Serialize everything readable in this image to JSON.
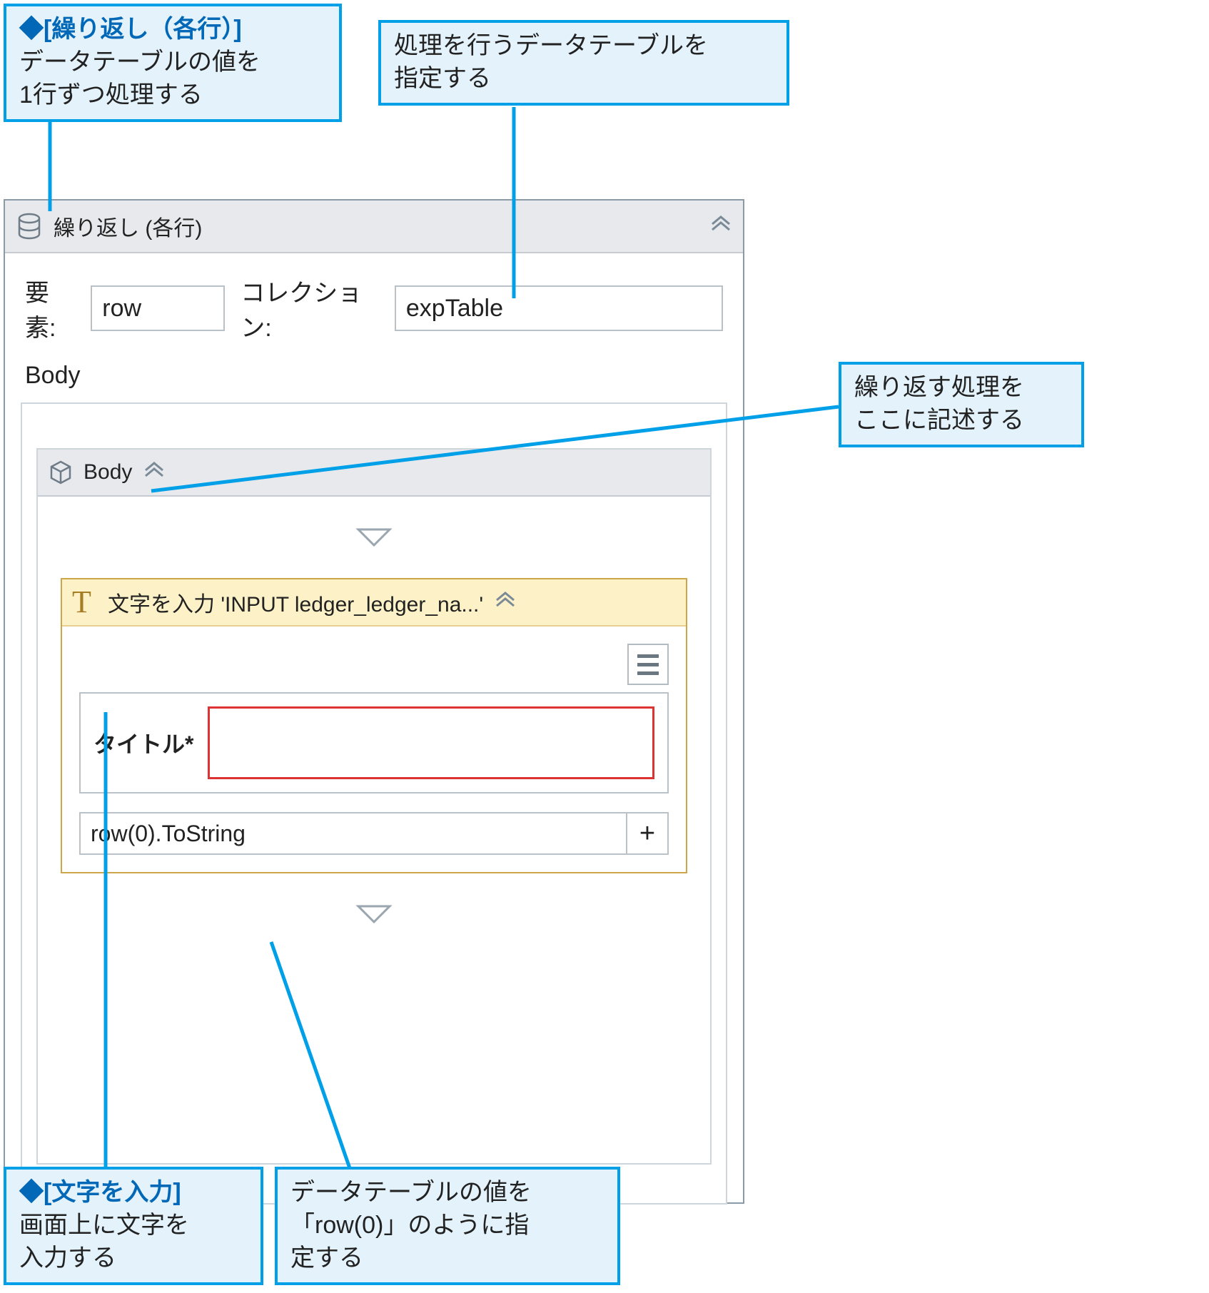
{
  "callouts": {
    "foreach": {
      "lead": "◆[繰り返し（各行）]",
      "line1": "データテーブルの値を",
      "line2": "1行ずつ処理する"
    },
    "datatable": {
      "line1": "処理を行うデータテーブルを",
      "line2": "指定する"
    },
    "bodyDesc": {
      "line1": "繰り返す処理を",
      "line2": "ここに記述する"
    },
    "typeInto": {
      "lead": "◆[文字を入力]",
      "line1": "画面上に文字を",
      "line2": "入力する"
    },
    "rowExpr": {
      "line1": "データテーブルの値を",
      "line2": "「row(0)」のように指",
      "line3": "定する"
    }
  },
  "panel": {
    "title": "繰り返し (各行)",
    "elemLabel": "要素:",
    "elemValue": "row",
    "collLabel": "コレクション:",
    "collValue": "expTable",
    "bodyLabel": "Body",
    "innerTitle": "Body"
  },
  "typeActivity": {
    "title": "文字を入力 'INPUT  ledger_ledger_na...'",
    "fieldLabel": "タイトル*",
    "expression": "row(0).ToString",
    "plus": "+"
  }
}
